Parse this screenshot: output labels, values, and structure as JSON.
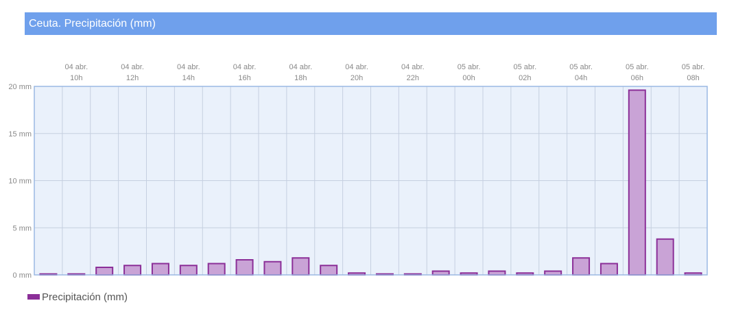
{
  "chart_data": {
    "type": "bar",
    "title": "Ceuta. Precipitación (mm)",
    "x_tick_labels": [
      {
        "date": "04 abr.",
        "hour": "10h"
      },
      {
        "date": "04 abr.",
        "hour": "12h"
      },
      {
        "date": "04 abr.",
        "hour": "14h"
      },
      {
        "date": "04 abr.",
        "hour": "16h"
      },
      {
        "date": "04 abr.",
        "hour": "18h"
      },
      {
        "date": "04 abr.",
        "hour": "20h"
      },
      {
        "date": "04 abr.",
        "hour": "22h"
      },
      {
        "date": "05 abr.",
        "hour": "00h"
      },
      {
        "date": "05 abr.",
        "hour": "02h"
      },
      {
        "date": "05 abr.",
        "hour": "04h"
      },
      {
        "date": "05 abr.",
        "hour": "06h"
      },
      {
        "date": "05 abr.",
        "hour": "08h"
      }
    ],
    "y_tick_labels": [
      "0 mm",
      "5 mm",
      "10 mm",
      "15 mm",
      "20 mm"
    ],
    "y_ticks": [
      0,
      5,
      10,
      15,
      20
    ],
    "ylim": [
      0,
      20
    ],
    "xlabel": "",
    "ylabel": "",
    "grid": true,
    "series": [
      {
        "name": "Precipitación (mm)",
        "values": [
          0.1,
          0.1,
          0.8,
          1.0,
          1.2,
          1.0,
          1.2,
          1.6,
          1.4,
          1.8,
          1.0,
          0.2,
          0.1,
          0.1,
          0.4,
          0.2,
          0.4,
          0.2,
          0.4,
          1.8,
          1.2,
          19.6,
          3.8,
          0.2
        ]
      }
    ],
    "legend_position": "bottom-left",
    "colors": {
      "bar_fill": "#c9a3d6",
      "bar_stroke": "#8b2f98",
      "plot_background": "#eaf1fb",
      "grid": "#c5cfe0",
      "axis": "#9ab8e3",
      "title_bar": "#6fa0ec"
    }
  }
}
